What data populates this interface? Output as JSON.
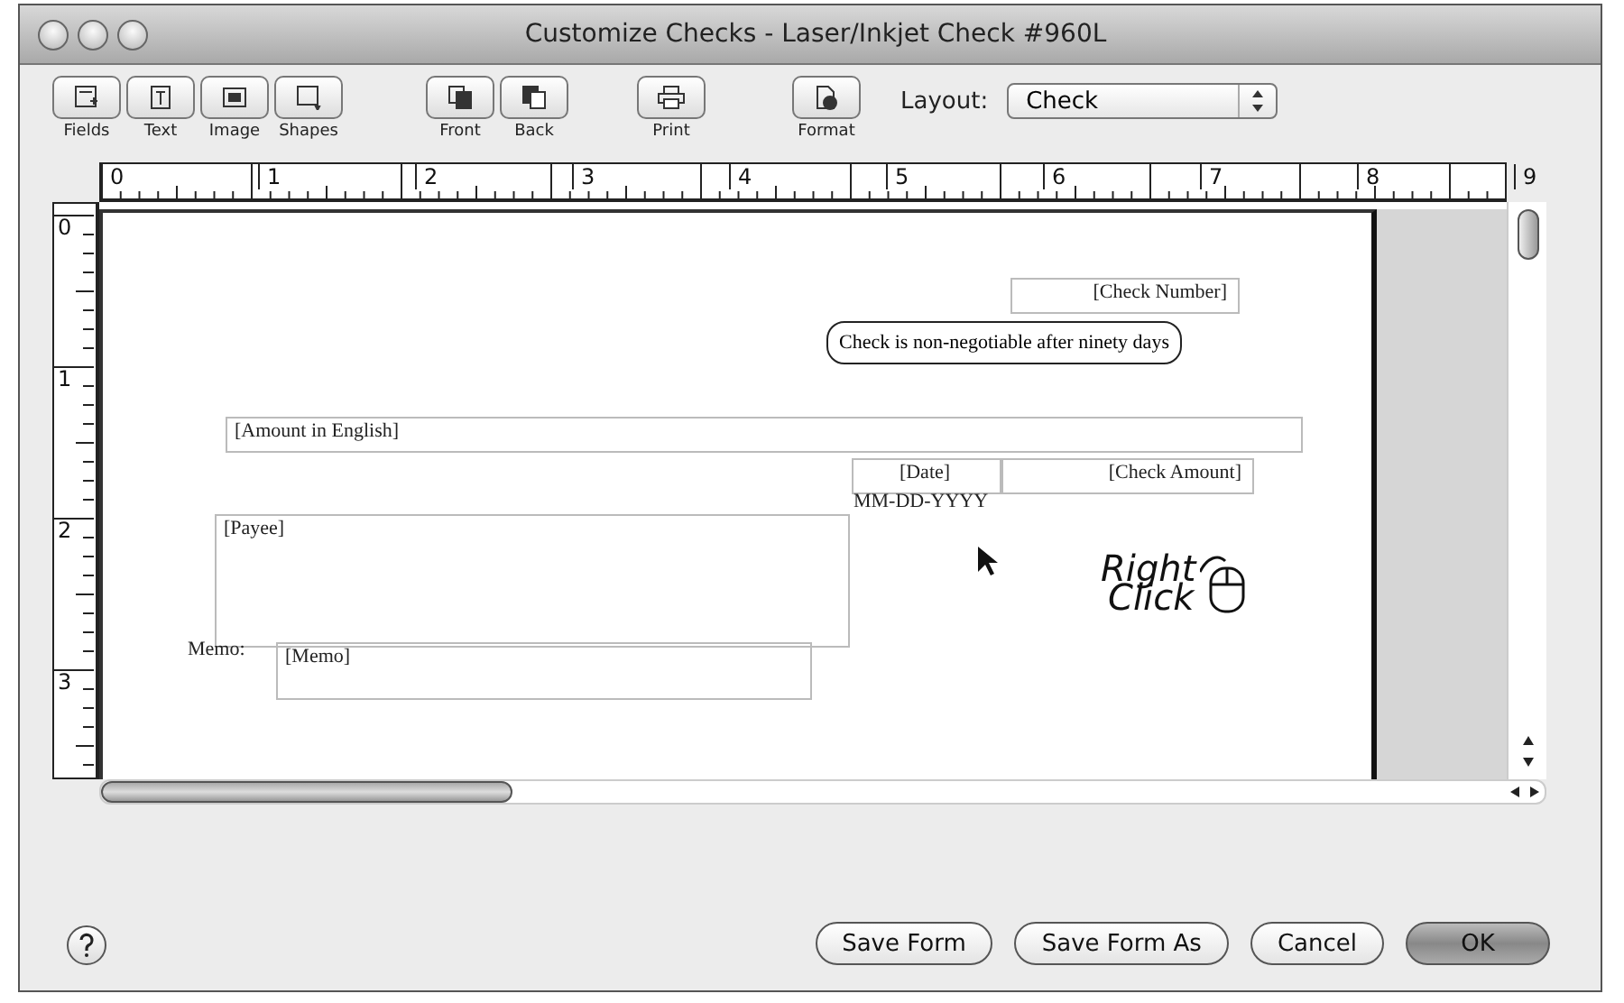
{
  "window": {
    "title": "Customize Checks - Laser/Inkjet Check #960L"
  },
  "toolbar": [
    {
      "label": "Fields",
      "kind": "fields"
    },
    {
      "label": "Text",
      "kind": "text"
    },
    {
      "label": "Image",
      "kind": "image"
    },
    {
      "label": "Shapes",
      "kind": "shapes"
    },
    {
      "label": "Front",
      "kind": "front"
    },
    {
      "label": "Back",
      "kind": "back"
    },
    {
      "label": "Print",
      "kind": "print"
    },
    {
      "label": "Format",
      "kind": "format"
    }
  ],
  "layout": {
    "label": "Layout:",
    "value": "Check"
  },
  "ruler": {
    "horizontal": [
      "0",
      "1",
      "2",
      "3",
      "4",
      "5",
      "6",
      "7",
      "8",
      "9"
    ],
    "vertical": [
      "0",
      "1",
      "2",
      "3"
    ]
  },
  "check_fields": [
    {
      "kind": "field",
      "text": "[Check Number]"
    },
    {
      "kind": "note",
      "text": "Check is non-negotiable after ninety days"
    },
    {
      "kind": "field",
      "text": "[Amount in English]"
    },
    {
      "kind": "field",
      "text": "[Date]"
    },
    {
      "kind": "label",
      "text": "MM-DD-YYYY"
    },
    {
      "kind": "field",
      "text": "[Check Amount]"
    },
    {
      "kind": "field",
      "text": "[Payee]"
    },
    {
      "kind": "label",
      "text": "Memo:"
    },
    {
      "kind": "field",
      "text": "[Memo]"
    }
  ],
  "logo": {
    "line1": "Right",
    "line2": "Click"
  },
  "buttons": [
    {
      "label": "Save Form",
      "kind": "normal"
    },
    {
      "label": "Save Form As",
      "kind": "normal"
    },
    {
      "label": "Cancel",
      "kind": "normal"
    },
    {
      "label": "OK",
      "kind": "default"
    }
  ]
}
